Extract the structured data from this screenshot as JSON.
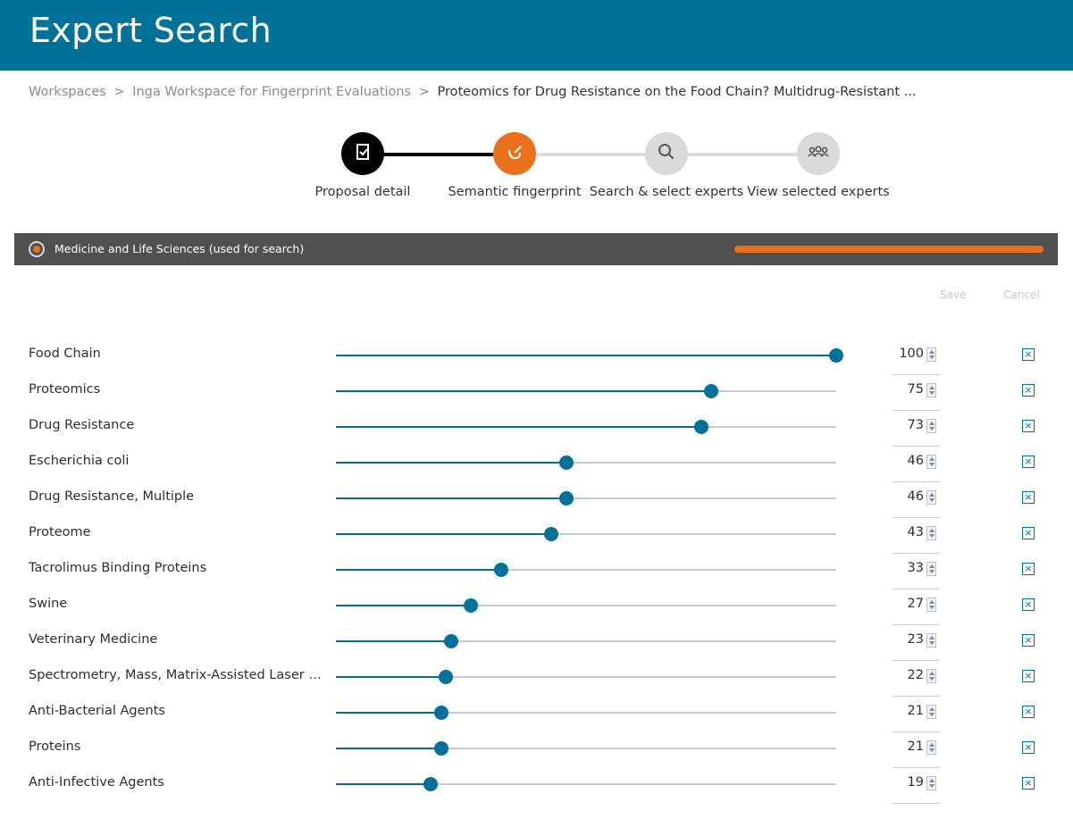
{
  "header": {
    "title": "Expert Search"
  },
  "breadcrumb": {
    "items": [
      "Workspaces",
      "Inga Workspace for Fingerprint Evaluations"
    ],
    "separator": ">",
    "current": "Proteomics for Drug Resistance on the Food Chain? Multidrug-Resistant ..."
  },
  "stepper": {
    "steps": [
      {
        "label": "Proposal detail",
        "icon": "document-check-icon",
        "state": "completed"
      },
      {
        "label": "Semantic fingerprint",
        "icon": "fingerprint-edit-icon",
        "state": "active"
      },
      {
        "label": "Search & select experts",
        "icon": "search-icon",
        "state": "pending"
      },
      {
        "label": "View selected experts",
        "icon": "group-icon",
        "state": "pending"
      }
    ]
  },
  "panel": {
    "label": "Medicine and Life Sciences (used for search)",
    "progress_percent": 100
  },
  "actions": {
    "save": "Save",
    "cancel": "Cancel"
  },
  "concepts": [
    {
      "name": "Food Chain",
      "weight": 100
    },
    {
      "name": "Proteomics",
      "weight": 75
    },
    {
      "name": "Drug Resistance",
      "weight": 73
    },
    {
      "name": "Escherichia coli",
      "weight": 46
    },
    {
      "name": "Drug Resistance, Multiple",
      "weight": 46
    },
    {
      "name": "Proteome",
      "weight": 43
    },
    {
      "name": "Tacrolimus Binding Proteins",
      "weight": 33
    },
    {
      "name": "Swine",
      "weight": 27
    },
    {
      "name": "Veterinary Medicine",
      "weight": 23
    },
    {
      "name": "Spectrometry, Mass, Matrix-Assisted Laser Desor...",
      "weight": 22
    },
    {
      "name": "Anti-Bacterial Agents",
      "weight": 21
    },
    {
      "name": "Proteins",
      "weight": 21
    },
    {
      "name": "Anti-Infective Agents",
      "weight": 19
    }
  ],
  "colors": {
    "brand": "#00729a",
    "accent": "#e9711c",
    "completed": "#000000",
    "pending": "#d9d9d9"
  }
}
